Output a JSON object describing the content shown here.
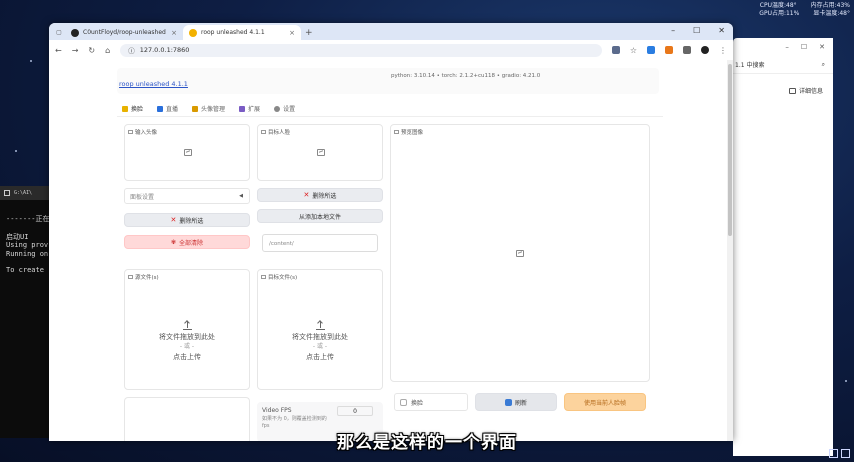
{
  "system_monitor": {
    "cpu_temp": "CPU温度:48°",
    "mem_usage": "内存占用:43%",
    "gpu_usage": "GPU占用:11%",
    "gpu_temp": "显卡温度:48°"
  },
  "bg_window": {
    "address_fragment": "1.1 中搜索",
    "detail_label": "详细信息"
  },
  "terminal": {
    "title": "G:\\AI\\",
    "lines": [
      "-------正在",
      "启动UI",
      "Using prov",
      "Running on",
      "To create"
    ]
  },
  "browser": {
    "tabs": [
      {
        "title": "C0untFloyd/roop-unleashed",
        "close": "×",
        "color": "#222222"
      },
      {
        "title": "roop unleashed 4.1.1",
        "close": "×",
        "color": "#f2b100"
      }
    ],
    "new_tab": "+",
    "window_controls": {
      "minimize": "–",
      "maximize": "☐",
      "close": "✕"
    },
    "url": "127.0.0.1:7860"
  },
  "app": {
    "title_link": "roop unleashed 4.1.1",
    "version_info": "python: 3.10.14 • torch: 2.1.2+cu118 • gradio: 4.21.0",
    "tabs": [
      {
        "label": "换脸",
        "color": "#e8b200"
      },
      {
        "label": "直播",
        "color": "#2a6fdb"
      },
      {
        "label": "头像管理",
        "color": "#d99a00"
      },
      {
        "label": "扩展",
        "color": "#7a5cc4"
      },
      {
        "label": "设置",
        "color": "#888888"
      }
    ],
    "input_face_label": "输入头像",
    "target_face_label": "目标人脸",
    "preview_label": "预览图像",
    "preset_placeholder": "面板设置",
    "btn_delete_selected_left": "删除所选",
    "btn_delete_selected_right": "删除所选",
    "btn_clear_all": "全部清除",
    "btn_add_local": "从添加本地文件",
    "textarea_placeholder": "/content/",
    "source_files_label": "源文件(s)",
    "target_files_label": "目标文件(s)",
    "drop_text": "将文件拖放到此处",
    "or_text": "- 或 -",
    "click_upload": "点击上传",
    "checkbox_label": "换脸",
    "btn_refresh": "刷新",
    "btn_use_face": "使用当前人脸帧",
    "video_fps_label": "Video FPS",
    "video_fps_hint": "如果不为 0，则覆盖检测到的 fps",
    "video_fps_value": "0",
    "bottom_number": "1"
  },
  "subtitle": "那么是这样的一个界面",
  "colors": {
    "accent_link": "#2b54c7",
    "danger": "#ffd9d9",
    "primary_orange": "#fcd39d"
  }
}
